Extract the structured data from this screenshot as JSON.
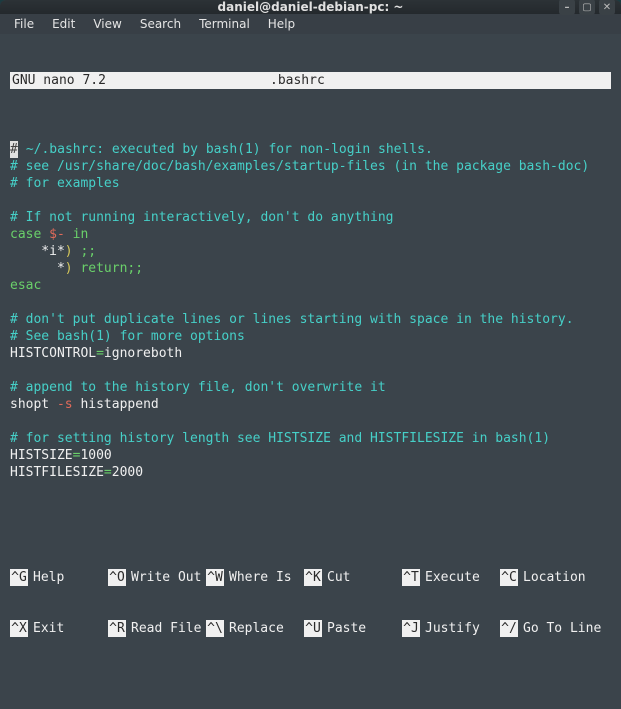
{
  "window": {
    "title": "daniel@daniel-debian-pc: ~"
  },
  "menubar": [
    "File",
    "Edit",
    "View",
    "Search",
    "Terminal",
    "Help"
  ],
  "nano": {
    "app": "GNU nano 7.2",
    "filename": ".bashrc",
    "lines": [
      {
        "segs": [
          [
            "cur",
            "#"
          ],
          [
            "c-cyan",
            " ~/.bashrc: executed by bash(1) for non-login shells."
          ]
        ]
      },
      {
        "segs": [
          [
            "c-cyan",
            "# see /usr/share/doc/bash/examples/startup-files (in the package bash-doc)"
          ]
        ]
      },
      {
        "segs": [
          [
            "c-cyan",
            "# for examples"
          ]
        ]
      },
      {
        "segs": [
          [
            "",
            ""
          ]
        ]
      },
      {
        "segs": [
          [
            "c-cyan",
            "# If not running interactively, don't do anything"
          ]
        ]
      },
      {
        "segs": [
          [
            "c-green",
            "case"
          ],
          [
            "c-wht",
            " "
          ],
          [
            "c-red",
            "$-"
          ],
          [
            "c-wht",
            " "
          ],
          [
            "c-green",
            "in"
          ]
        ]
      },
      {
        "segs": [
          [
            "c-wht",
            "    *i*"
          ],
          [
            "c-yell",
            ")"
          ],
          [
            "c-wht",
            " "
          ],
          [
            "c-green",
            ";;"
          ]
        ]
      },
      {
        "segs": [
          [
            "c-wht",
            "      *"
          ],
          [
            "c-yell",
            ")"
          ],
          [
            "c-wht",
            " "
          ],
          [
            "c-green",
            "return"
          ],
          [
            "c-green",
            ";;"
          ]
        ]
      },
      {
        "segs": [
          [
            "c-green",
            "esac"
          ]
        ]
      },
      {
        "segs": [
          [
            "",
            ""
          ]
        ]
      },
      {
        "segs": [
          [
            "c-cyan",
            "# don't put duplicate lines or lines starting with space in the history."
          ]
        ]
      },
      {
        "segs": [
          [
            "c-cyan",
            "# See bash(1) for more options"
          ]
        ]
      },
      {
        "segs": [
          [
            "c-wht",
            "HISTCONTROL"
          ],
          [
            "c-green",
            "="
          ],
          [
            "c-wht",
            "ignoreboth"
          ]
        ]
      },
      {
        "segs": [
          [
            "",
            ""
          ]
        ]
      },
      {
        "segs": [
          [
            "c-cyan",
            "# append to the history file, don't overwrite it"
          ]
        ]
      },
      {
        "segs": [
          [
            "c-wht",
            "shopt "
          ],
          [
            "c-red",
            "-s"
          ],
          [
            "c-wht",
            " histappend"
          ]
        ]
      },
      {
        "segs": [
          [
            "",
            ""
          ]
        ]
      },
      {
        "segs": [
          [
            "c-cyan",
            "# for setting history length see HISTSIZE and HISTFILESIZE in bash(1)"
          ]
        ]
      },
      {
        "segs": [
          [
            "c-wht",
            "HISTSIZE"
          ],
          [
            "c-green",
            "="
          ],
          [
            "c-wht",
            "1000"
          ]
        ]
      },
      {
        "segs": [
          [
            "c-wht",
            "HISTFILESIZE"
          ],
          [
            "c-green",
            "="
          ],
          [
            "c-wht",
            "2000"
          ]
        ]
      }
    ],
    "shortcuts": {
      "row1": [
        {
          "key": "^G",
          "label": "Help"
        },
        {
          "key": "^O",
          "label": "Write Out"
        },
        {
          "key": "^W",
          "label": "Where Is"
        },
        {
          "key": "^K",
          "label": "Cut"
        },
        {
          "key": "^T",
          "label": "Execute"
        },
        {
          "key": "^C",
          "label": "Location"
        }
      ],
      "row2": [
        {
          "key": "^X",
          "label": "Exit"
        },
        {
          "key": "^R",
          "label": "Read File"
        },
        {
          "key": "^\\",
          "label": "Replace"
        },
        {
          "key": "^U",
          "label": "Paste"
        },
        {
          "key": "^J",
          "label": "Justify"
        },
        {
          "key": "^/",
          "label": "Go To Line"
        }
      ]
    }
  }
}
